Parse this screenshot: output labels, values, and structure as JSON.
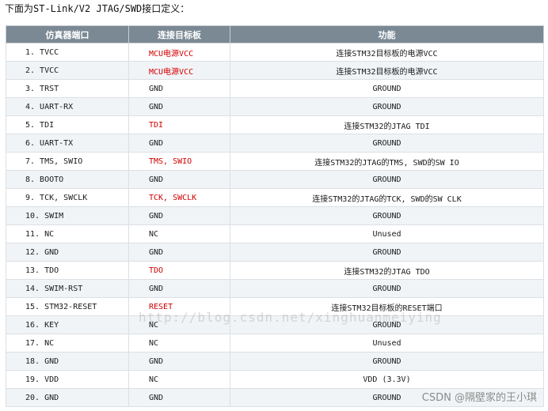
{
  "intro_text": "下面为ST-Link/V2 JTAG/SWD接口定义：",
  "headers": [
    "仿真器端口",
    "连接目标板",
    "功能"
  ],
  "rows": [
    {
      "port": "1.  TVCC",
      "target": "MCU电源VCC",
      "target_red": true,
      "func": "连接STM32目标板的电源VCC"
    },
    {
      "port": "2.  TVCC",
      "target": "MCU电源VCC",
      "target_red": true,
      "func": "连接STM32目标板的电源VCC"
    },
    {
      "port": "3.  TRST",
      "target": "GND",
      "target_red": false,
      "func": "GROUND"
    },
    {
      "port": "4.  UART-RX",
      "target": "GND",
      "target_red": false,
      "func": "GROUND"
    },
    {
      "port": "5.  TDI",
      "target": "TDI",
      "target_red": true,
      "func": "连接STM32的JTAG TDI"
    },
    {
      "port": "6.  UART-TX",
      "target": "GND",
      "target_red": false,
      "func": "GROUND"
    },
    {
      "port": "7.  TMS, SWIO",
      "target": "TMS, SWIO",
      "target_red": true,
      "func": "连接STM32的JTAG的TMS, SWD的SW IO"
    },
    {
      "port": "8.  BOOTO",
      "target": "GND",
      "target_red": false,
      "func": "GROUND"
    },
    {
      "port": "9.  TCK, SWCLK",
      "target": "TCK, SWCLK",
      "target_red": true,
      "func": "连接STM32的JTAG的TCK, SWD的SW CLK"
    },
    {
      "port": "10.  SWIM",
      "target": "GND",
      "target_red": false,
      "func": "GROUND"
    },
    {
      "port": "11.  NC",
      "target": "NC",
      "target_red": false,
      "func": "Unused"
    },
    {
      "port": "12.  GND",
      "target": "GND",
      "target_red": false,
      "func": "GROUND"
    },
    {
      "port": "13.  TDO",
      "target": "TDO",
      "target_red": true,
      "func": "连接STM32的JTAG TDO"
    },
    {
      "port": "14.  SWIM-RST",
      "target": "GND",
      "target_red": false,
      "func": "GROUND"
    },
    {
      "port": "15.  STM32-RESET",
      "target": "RESET",
      "target_red": true,
      "func": "连接STM32目标板的RESET端口"
    },
    {
      "port": "16.  KEY",
      "target": "NC",
      "target_red": false,
      "func": "GROUND"
    },
    {
      "port": "17.  NC",
      "target": "NC",
      "target_red": false,
      "func": "Unused"
    },
    {
      "port": "18.  GND",
      "target": "GND",
      "target_red": false,
      "func": "GROUND"
    },
    {
      "port": "19.  VDD",
      "target": "NC",
      "target_red": false,
      "func": "VDD (3.3V)"
    },
    {
      "port": "20.  GND",
      "target": "GND",
      "target_red": false,
      "func": "GROUND"
    }
  ],
  "watermark_url": "http://blog.csdn.net/xinghuanmeiying",
  "watermark_csdn": "CSDN @隔壁家的王小琪"
}
